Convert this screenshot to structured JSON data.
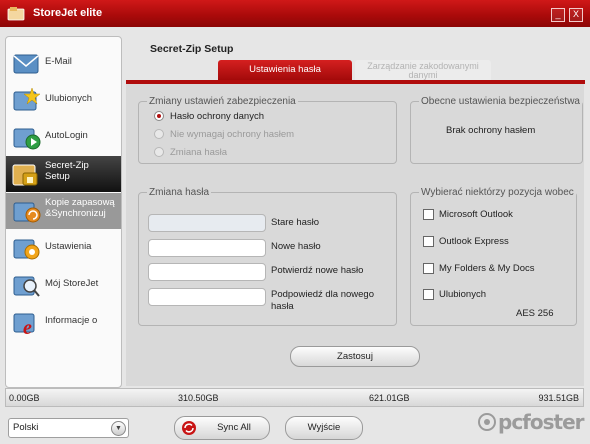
{
  "window": {
    "title": "StoreJet elite"
  },
  "window_controls": {
    "minimize": "_",
    "close": "X"
  },
  "sidebar": {
    "items": [
      {
        "label": "E-Mail",
        "state": "normal"
      },
      {
        "label": "Ulubionych",
        "state": "normal"
      },
      {
        "label": "AutoLogin",
        "state": "normal"
      },
      {
        "label": "Secret-Zip Setup",
        "state": "active"
      },
      {
        "label": "Kopie zapasową &Synchronizuj",
        "state": "hover"
      },
      {
        "label": "Ustawienia",
        "state": "normal"
      },
      {
        "label": "Mój StoreJet",
        "state": "normal"
      },
      {
        "label": "Informacje o",
        "state": "normal"
      }
    ]
  },
  "page": {
    "title": "Secret-Zip Setup"
  },
  "tabs": [
    {
      "label": "Ustawienia hasła",
      "active": true
    },
    {
      "label": "Zarządzanie zakodowanymi danymi",
      "active": false
    }
  ],
  "security": {
    "legend": "Zmiany ustawień zabezpieczenia",
    "options": [
      {
        "label": "Hasło ochrony danych",
        "selected": true,
        "enabled": true
      },
      {
        "label": "Nie wymagaj ochrony hasłem",
        "selected": false,
        "enabled": false
      },
      {
        "label": "Zmiana hasła",
        "selected": false,
        "enabled": false
      }
    ]
  },
  "current": {
    "legend": "Obecne ustawienia bezpieczeństwa",
    "value": "Brak ochrony hasłem"
  },
  "password": {
    "legend": "Zmiana hasła",
    "fields": [
      {
        "label": "Stare hasło",
        "value": ""
      },
      {
        "label": "Nowe hasło",
        "value": ""
      },
      {
        "label": "Potwierdź nowe hasło",
        "value": ""
      },
      {
        "label": "Podpowiedź dla nowego hasła",
        "value": ""
      }
    ]
  },
  "items": {
    "legend": "Wybierać niektórzy pozycja wobec",
    "options": [
      {
        "label": "Microsoft Outlook",
        "checked": false
      },
      {
        "label": "Outlook Express",
        "checked": false
      },
      {
        "label": "My Folders & My Docs",
        "checked": false
      },
      {
        "label": "Ulubionych",
        "checked": false
      }
    ],
    "encryption": "AES 256"
  },
  "apply_label": "Zastosuj",
  "capacity": {
    "ticks": [
      "0.00GB",
      "310.50GB",
      "621.01GB",
      "931.51GB"
    ]
  },
  "language": {
    "selected": "Polski"
  },
  "buttons": {
    "sync_all": "Sync All",
    "exit": "Wyjście"
  },
  "watermark": "pcfoster",
  "colors": {
    "accent": "#b00c0c",
    "active_nav": "#1a1a1a"
  }
}
